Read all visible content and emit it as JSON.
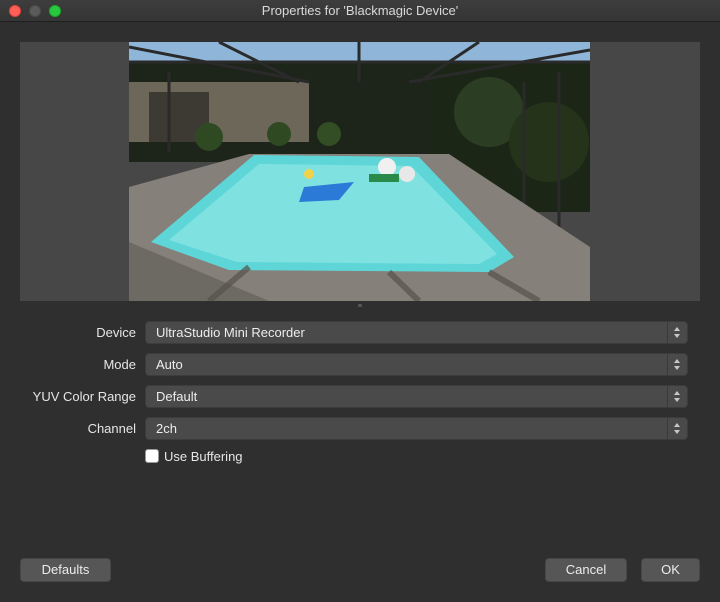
{
  "window": {
    "title": "Properties for 'Blackmagic Device'"
  },
  "preview": {
    "description_icon": "video-preview"
  },
  "form": {
    "device": {
      "label": "Device",
      "value": "UltraStudio Mini Recorder"
    },
    "mode": {
      "label": "Mode",
      "value": "Auto"
    },
    "yuv_color_range": {
      "label": "YUV Color Range",
      "value": "Default"
    },
    "channel": {
      "label": "Channel",
      "value": "2ch"
    },
    "use_buffering": {
      "label": "Use Buffering",
      "checked": false
    }
  },
  "buttons": {
    "defaults": "Defaults",
    "cancel": "Cancel",
    "ok": "OK"
  },
  "colors": {
    "background": "#2f2f2f",
    "control": "#4a4a4a",
    "close": "#fe5f57",
    "maximize": "#28c840"
  }
}
